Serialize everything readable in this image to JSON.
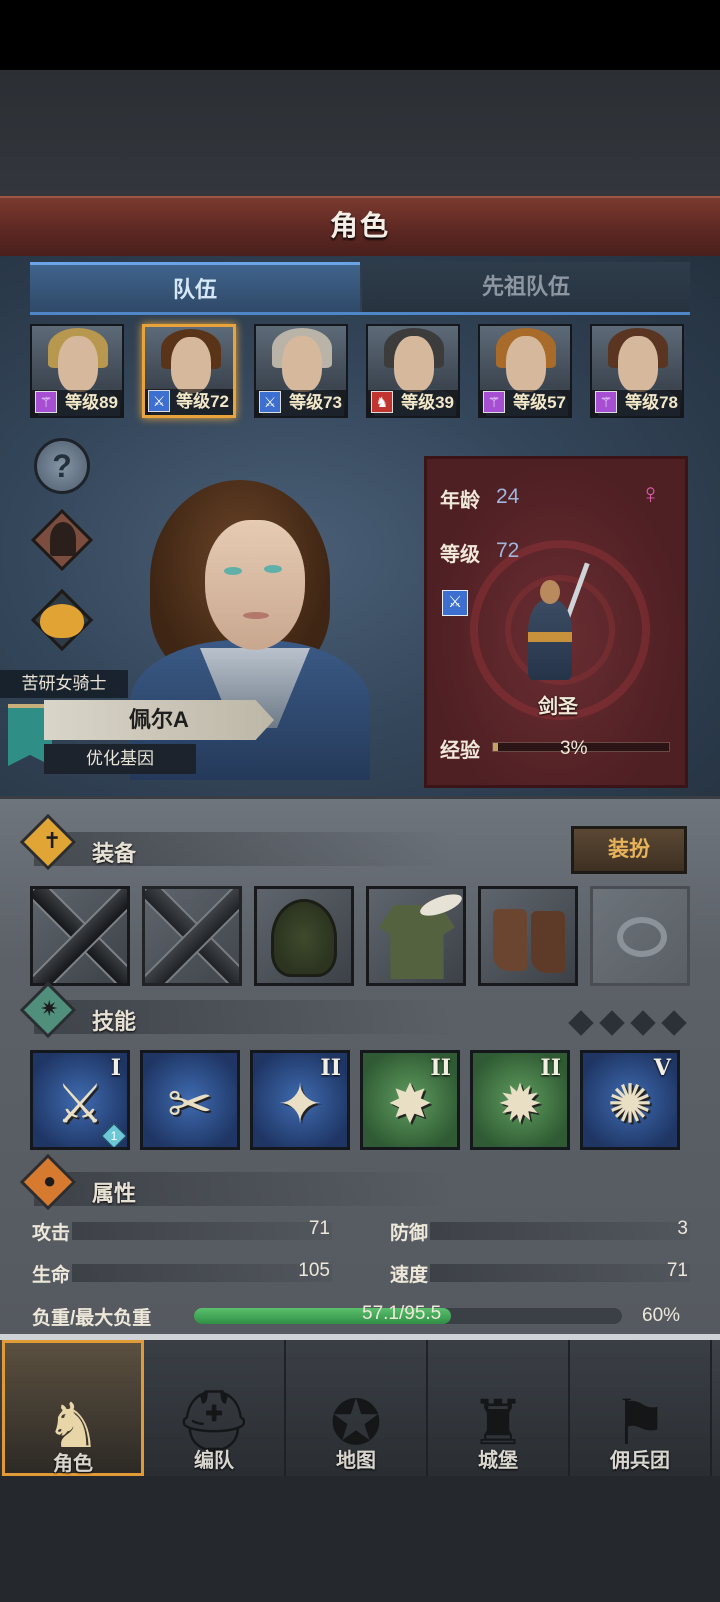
{
  "header": {
    "title": "角色"
  },
  "tabs": [
    {
      "label": "队伍"
    },
    {
      "label": "先祖队伍"
    }
  ],
  "party": [
    {
      "level_text": "等级89",
      "class_icon": "staff-icon",
      "color": "#a64fd3",
      "hair": "#b8974f",
      "selected": false
    },
    {
      "level_text": "等级72",
      "class_icon": "sword-icon",
      "color": "#3d6fd1",
      "hair": "#5a3418",
      "selected": true
    },
    {
      "level_text": "等级73",
      "class_icon": "sword-icon",
      "color": "#3d6fd1",
      "hair": "#b9b3a8",
      "selected": false
    },
    {
      "level_text": "等级39",
      "class_icon": "beast-icon",
      "color": "#c0352f",
      "hair": "#3c3c3c",
      "selected": false
    },
    {
      "level_text": "等级57",
      "class_icon": "staff-icon",
      "color": "#a64fd3",
      "hair": "#a86b2a",
      "selected": false
    },
    {
      "level_text": "等级78",
      "class_icon": "staff-icon",
      "color": "#a64fd3",
      "hair": "#5a3522",
      "selected": false
    }
  ],
  "character": {
    "title": "苦研女骑士",
    "name": "佩尔A",
    "gene": "优化基因",
    "age_label": "年龄",
    "age": "24",
    "level_label": "等级",
    "level": "72",
    "class_name": "剑圣",
    "exp_label": "经验",
    "exp": "3%",
    "exp_fraction": 0.03,
    "gender_icon": "female-icon"
  },
  "equipment": {
    "title": "装备",
    "dress_button": "装扮",
    "slots": [
      "weapon-slot-icon",
      "weapon-slot-icon",
      "hood-icon",
      "tunic-icon",
      "boots-icon",
      "ring-icon"
    ]
  },
  "skills": {
    "title": "技能",
    "items": [
      {
        "rank": "I",
        "glyph": "⚔",
        "tone": "blue",
        "badge": "1"
      },
      {
        "rank": "",
        "glyph": "✂",
        "tone": "blue",
        "badge": ""
      },
      {
        "rank": "II",
        "glyph": "✦",
        "tone": "blue",
        "badge": ""
      },
      {
        "rank": "II",
        "glyph": "✸",
        "tone": "green",
        "badge": ""
      },
      {
        "rank": "II",
        "glyph": "✹",
        "tone": "green",
        "badge": ""
      },
      {
        "rank": "V",
        "glyph": "✺",
        "tone": "blue",
        "badge": ""
      }
    ]
  },
  "attributes": {
    "title": "属性",
    "attack_label": "攻击",
    "attack": "71",
    "defense_label": "防御",
    "defense": "3",
    "hp_label": "生命",
    "hp": "105",
    "speed_label": "速度",
    "speed": "71",
    "weight_label": "负重/最大负重",
    "weight": "57.1/95.5",
    "weight_pct": "60%",
    "weight_fraction": 0.6
  },
  "nav": [
    {
      "label": "角色",
      "icon": "knight-icon",
      "glyph": "♞"
    },
    {
      "label": "编队",
      "icon": "helmet-icon",
      "glyph": "⛑"
    },
    {
      "label": "地图",
      "icon": "compass-icon",
      "glyph": "✪"
    },
    {
      "label": "城堡",
      "icon": "castle-icon",
      "glyph": "♜"
    },
    {
      "label": "佣兵团",
      "icon": "banner-icon",
      "glyph": "⚑"
    }
  ]
}
